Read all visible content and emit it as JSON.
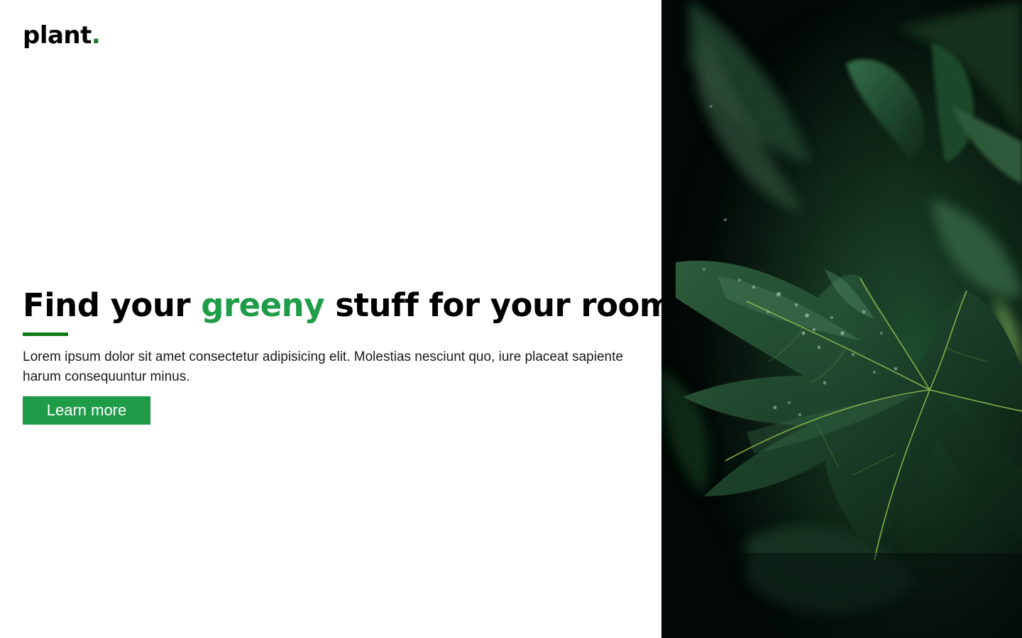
{
  "brand": {
    "name": "plant",
    "dot": ".",
    "accent_color": "#1a7a2e"
  },
  "hero": {
    "headline_start": "Find your ",
    "headline_accent": "greeny",
    "headline_end": " stuff for your room",
    "accent_color": "#1f9c48",
    "body": "Lorem ipsum dolor sit amet consectetur adipisicing elit. Molestias nesciunt quo, iure placeat sapiente harum consequuntur minus.",
    "cta_label": "Learn more",
    "cta_color": "#1f9c48"
  },
  "image": {
    "subject": "dark-green-leaves-photo"
  }
}
